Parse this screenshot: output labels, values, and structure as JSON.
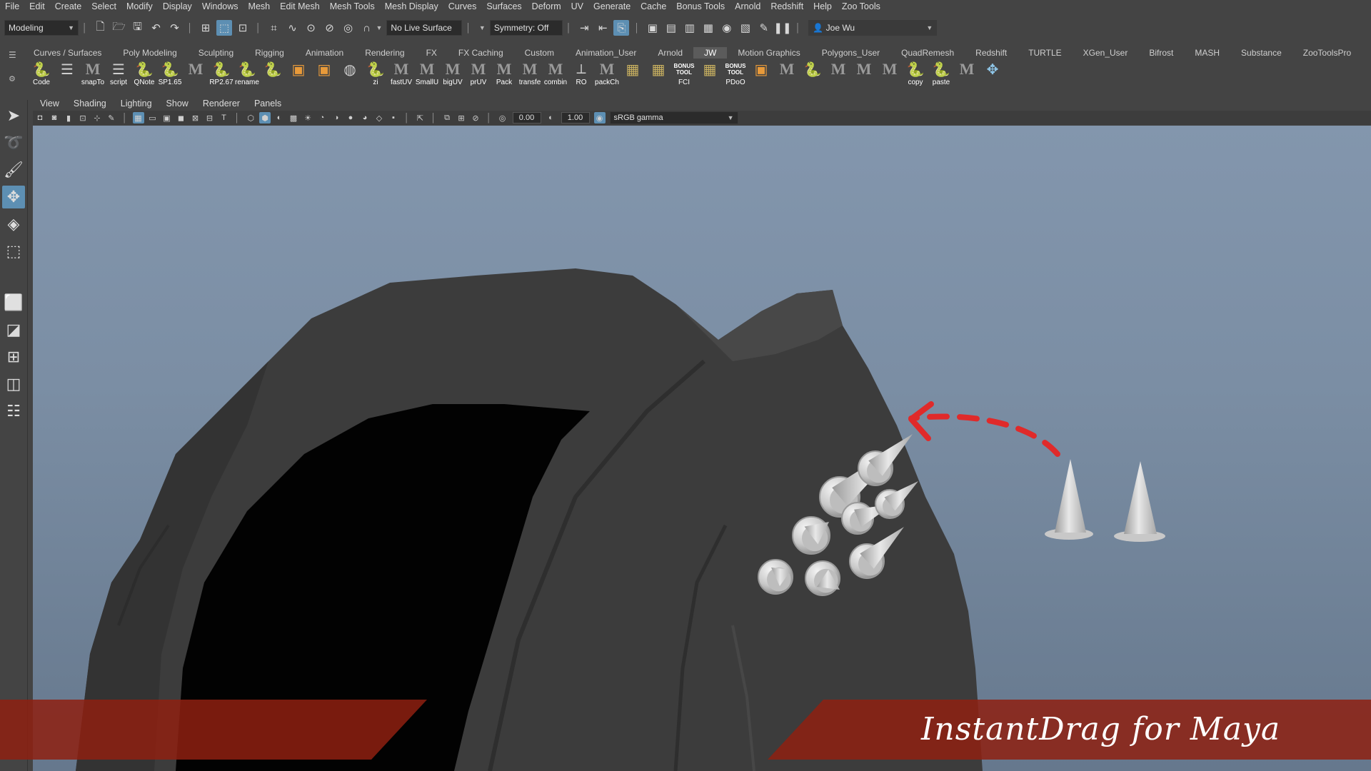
{
  "menu": [
    "File",
    "Edit",
    "Create",
    "Select",
    "Modify",
    "Display",
    "Windows",
    "Mesh",
    "Edit Mesh",
    "Mesh Tools",
    "Mesh Display",
    "Curves",
    "Surfaces",
    "Deform",
    "UV",
    "Generate",
    "Cache",
    "Bonus Tools",
    "Arnold",
    "Redshift",
    "Help",
    "Zoo Tools"
  ],
  "status": {
    "mode": "Modeling",
    "live_surface": "No Live Surface",
    "symmetry": "Symmetry: Off",
    "user": "Joe Wu"
  },
  "shelf_tabs": [
    "Curves / Surfaces",
    "Poly Modeling",
    "Sculpting",
    "Rigging",
    "Animation",
    "Rendering",
    "FX",
    "FX Caching",
    "Custom",
    "Animation_User",
    "Arnold",
    "JW",
    "Motion Graphics",
    "Polygons_User",
    "QuadRemesh",
    "Redshift",
    "TURTLE",
    "XGen_User",
    "Bifrost",
    "MASH",
    "Substance",
    "ZooToolsPro"
  ],
  "active_shelf_tab": "JW",
  "shelf_buttons": [
    {
      "label": "Code",
      "icon": "python-icon"
    },
    {
      "label": "",
      "icon": "list-icon"
    },
    {
      "label": "snapTo",
      "icon": "maya-m-icon"
    },
    {
      "label": "script",
      "icon": "list-icon"
    },
    {
      "label": "QNote",
      "icon": "python-icon"
    },
    {
      "label": "SP1.65",
      "icon": "python-icon"
    },
    {
      "label": "",
      "icon": "maya-m-icon"
    },
    {
      "label": "RP2.67",
      "icon": "python-icon"
    },
    {
      "label": "rename",
      "icon": "python-icon"
    },
    {
      "label": "",
      "icon": "python-icon"
    },
    {
      "label": "",
      "icon": "cube-orange-icon"
    },
    {
      "label": "",
      "icon": "cube-orange-icon"
    },
    {
      "label": "",
      "icon": "sphere-icon"
    },
    {
      "label": "zi",
      "icon": "python-icon"
    },
    {
      "label": "fastUV",
      "icon": "maya-m-icon"
    },
    {
      "label": "SmallU",
      "icon": "maya-m-icon"
    },
    {
      "label": "bigUV",
      "icon": "maya-m-icon"
    },
    {
      "label": "prUV",
      "icon": "maya-m-icon"
    },
    {
      "label": "Pack",
      "icon": "maya-m-icon"
    },
    {
      "label": "transfe",
      "icon": "maya-m-icon"
    },
    {
      "label": "combin",
      "icon": "maya-m-icon"
    },
    {
      "label": "RO",
      "icon": "axis-icon"
    },
    {
      "label": "packCh",
      "icon": "maya-m-icon"
    },
    {
      "label": "",
      "icon": "grid-icon"
    },
    {
      "label": "",
      "icon": "grid-icon"
    },
    {
      "label": "FCI",
      "icon": "bonus-tool-icon"
    },
    {
      "label": "",
      "icon": "grid-icon"
    },
    {
      "label": "PDoO",
      "icon": "bonus-tool-icon"
    },
    {
      "label": "",
      "icon": "cube-orange-icon"
    },
    {
      "label": "",
      "icon": "maya-m-icon"
    },
    {
      "label": "",
      "icon": "python-icon"
    },
    {
      "label": "",
      "icon": "maya-m-icon"
    },
    {
      "label": "",
      "icon": "maya-m-icon"
    },
    {
      "label": "",
      "icon": "maya-m-icon"
    },
    {
      "label": "copy",
      "icon": "python-icon"
    },
    {
      "label": "paste",
      "icon": "python-icon"
    },
    {
      "label": "",
      "icon": "maya-m-icon"
    },
    {
      "label": "",
      "icon": "move-icon"
    }
  ],
  "bonus_tool_label": "BONUS TOOL",
  "panel_menu": [
    "View",
    "Shading",
    "Lighting",
    "Show",
    "Renderer",
    "Panels"
  ],
  "panel": {
    "exposure": "0.00",
    "gamma": "1.00",
    "color_space": "sRGB gamma"
  },
  "brand_title": "InstantDrag for Maya",
  "colors": {
    "ui_bg": "#444444",
    "highlight": "#5d8fb3",
    "banner": "#8e2010",
    "arrow": "#e02a2a"
  }
}
